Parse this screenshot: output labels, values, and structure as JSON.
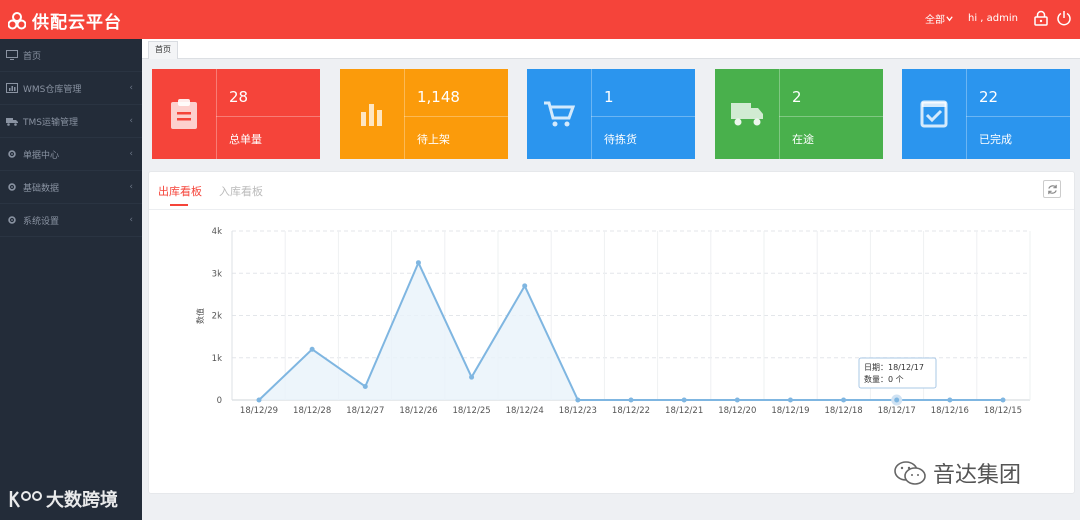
{
  "header": {
    "title": "供配云平台",
    "scope": "全部",
    "greeting": "hi , admin",
    "bg": "#f5443a"
  },
  "sidebar": {
    "items": [
      {
        "label": "首页",
        "icon": "monitor-icon",
        "has_arrow": false
      },
      {
        "label": "WMS仓库管理",
        "icon": "chart-icon",
        "has_arrow": true
      },
      {
        "label": "TMS运输管理",
        "icon": "truck-icon",
        "has_arrow": true
      },
      {
        "label": "单据中心",
        "icon": "gear-icon",
        "has_arrow": true
      },
      {
        "label": "基础数据",
        "icon": "gear-icon",
        "has_arrow": true
      },
      {
        "label": "系统设置",
        "icon": "gear-icon",
        "has_arrow": true
      }
    ]
  },
  "tabs": {
    "active": "首页"
  },
  "stats": [
    {
      "value": "28",
      "label": "总单量",
      "icon": "clipboard-icon",
      "color": "#f5443a"
    },
    {
      "value": "1,148",
      "label": "待上架",
      "icon": "bar-chart-icon",
      "color": "#fb9b0b"
    },
    {
      "value": "1",
      "label": "待拣货",
      "icon": "cart-icon",
      "color": "#2b95ee"
    },
    {
      "value": "2",
      "label": "在途",
      "icon": "truck-icon",
      "color": "#49b04c"
    },
    {
      "value": "22",
      "label": "已完成",
      "icon": "check-box-icon",
      "color": "#2b95ee"
    }
  ],
  "panel": {
    "tab_active": "出库看板",
    "tab_inactive": "入库看板"
  },
  "tooltip": {
    "line1": "日期：18/12/17",
    "line2": "数量：0 个"
  },
  "chart_data": {
    "type": "area",
    "categories": [
      "18/12/29",
      "18/12/28",
      "18/12/27",
      "18/12/26",
      "18/12/25",
      "18/12/24",
      "18/12/23",
      "18/12/22",
      "18/12/21",
      "18/12/20",
      "18/12/19",
      "18/12/18",
      "18/12/17",
      "18/12/16",
      "18/12/15"
    ],
    "values": [
      0,
      1200,
      320,
      3250,
      540,
      2700,
      0,
      0,
      0,
      0,
      0,
      0,
      0,
      0,
      0
    ],
    "ylabel": "数值",
    "yticks": [
      "0",
      "1k",
      "2k",
      "3k",
      "4k"
    ],
    "ylim": [
      0,
      4000
    ],
    "line_color": "#7fb6e1",
    "fill_color": "#e9f2fa",
    "grid": true,
    "highlight_index": 12
  },
  "watermarks": {
    "left": "大数跨境",
    "right": "音达集团"
  }
}
